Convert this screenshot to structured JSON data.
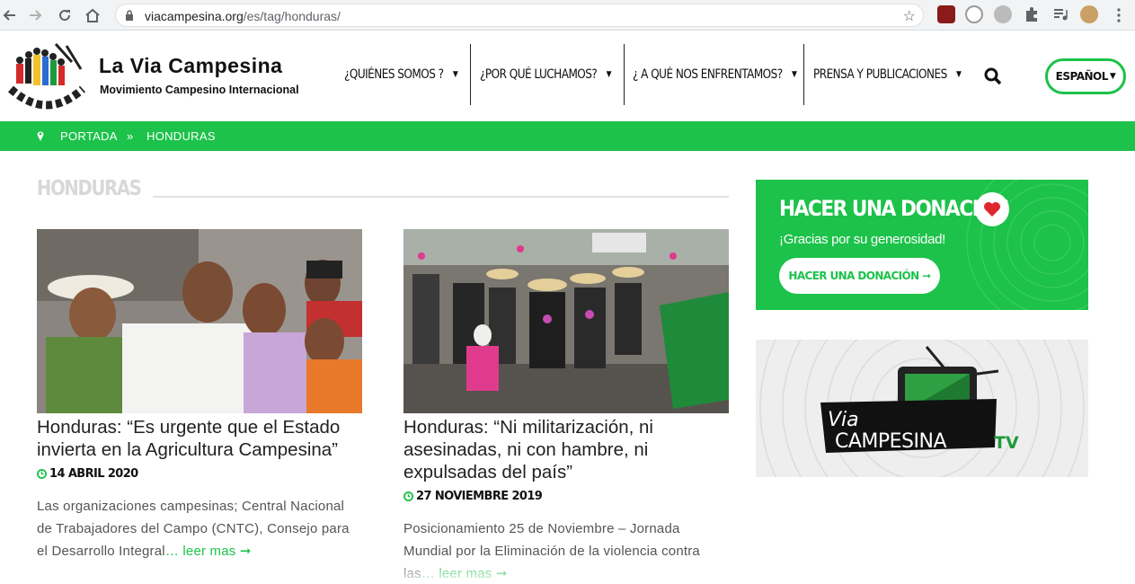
{
  "browser": {
    "url_domain": "viacampesina.org",
    "url_path": "/es/tag/honduras/"
  },
  "header": {
    "brand_title": "La Via Campesina",
    "brand_subtitle": "Movimiento Campesino Internacional",
    "menu": [
      {
        "label": "¿QUIÉNES SOMOS ?"
      },
      {
        "label": "¿POR QUÉ LUCHAMOS?"
      },
      {
        "label": "¿ A QUÉ NOS ENFRENTAMOS?"
      },
      {
        "label": "PRENSA Y PUBLICACIONES"
      }
    ],
    "language": "ESPAÑOL"
  },
  "breadcrumb": {
    "home": "PORTADA",
    "separator": "»",
    "current": "HONDURAS"
  },
  "page": {
    "title": "HONDURAS"
  },
  "articles": [
    {
      "title": "Honduras: “Es urgente que el Estado invierta en la Agricultura Campesina”",
      "date": "14 ABRIL 2020",
      "excerpt": "Las organizaciones campesinas; Central Nacional de Trabajadores del Campo (CNTC), Consejo para el Desarrollo Integral",
      "more": "… leer mas ➞"
    },
    {
      "title": "Honduras: “Ni militarización, ni asesinadas, ni con hambre, ni expulsadas del país”",
      "date": "27 NOVIEMBRE 2019",
      "excerpt": "Posicionamiento 25 de Noviembre – Jornada Mundial por la Eliminación de la violencia contra las",
      "more": "… leer mas ➞"
    }
  ],
  "sidebar": {
    "donation_title": "HACER UNA DONACIÓN",
    "donation_subtitle": "¡Gracias por su generosidad!",
    "donation_button": "HACER UNA DONACIÓN ➞",
    "tv_logo_text_1": "Via",
    "tv_logo_text_2": "CAMPESINA",
    "tv_logo_text_3": "TV"
  },
  "colors": {
    "accent": "#1cc24a",
    "heart": "#e0262f"
  }
}
